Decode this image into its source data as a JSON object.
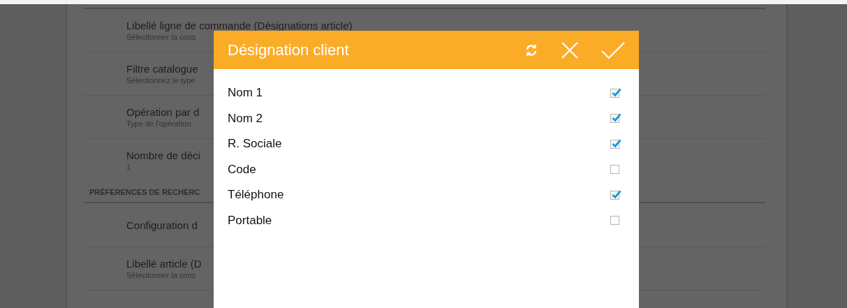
{
  "settings": {
    "rows": [
      {
        "kind": "item",
        "title": "Libellé ligne de commande (Désignations article)",
        "subtitle": "Sélectionner la cons"
      },
      {
        "kind": "item",
        "title": "Filtre catalogue",
        "subtitle": "Sélectionnez le type"
      },
      {
        "kind": "item",
        "title": "Opération par d",
        "subtitle": "Type de l'opération"
      },
      {
        "kind": "item",
        "title": "Nombre de déci",
        "subtitle": "1"
      },
      {
        "kind": "section",
        "title": "PRÉFERENCES DE RECHERC"
      },
      {
        "kind": "item",
        "title": "Configuration d"
      },
      {
        "kind": "item",
        "title": "Libellé article (D",
        "subtitle": "Sélectionner la cons"
      }
    ]
  },
  "dialog": {
    "title": "Désignation client",
    "options": [
      {
        "label": "Nom 1",
        "checked": true
      },
      {
        "label": "Nom 2",
        "checked": true
      },
      {
        "label": "R. Sociale",
        "checked": true
      },
      {
        "label": "Code",
        "checked": false
      },
      {
        "label": "Téléphone",
        "checked": true
      },
      {
        "label": "Portable",
        "checked": false
      }
    ]
  }
}
